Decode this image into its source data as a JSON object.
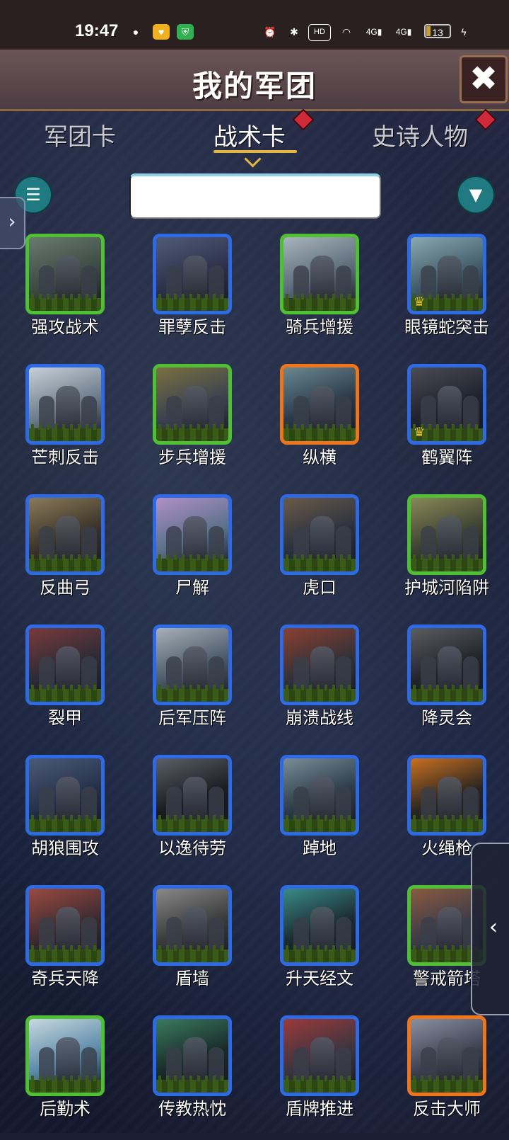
{
  "status_bar": {
    "time": "19:47",
    "battery": "13",
    "icons": [
      "wechat-icon",
      "app-icon",
      "shield-app-icon",
      "alarm-icon",
      "bluetooth-icon",
      "hd-icon",
      "wifi-icon",
      "signal-4g-icon",
      "signal-4g-icon",
      "battery-icon",
      "charging-icon"
    ]
  },
  "header": {
    "title": "我的军团",
    "close_label": "✖"
  },
  "tabs": [
    {
      "label": "军团卡",
      "active": false,
      "badge": false
    },
    {
      "label": "战术卡",
      "active": true,
      "badge": true
    },
    {
      "label": "史诗人物",
      "active": false,
      "badge": true
    }
  ],
  "search": {
    "value": "",
    "placeholder": ""
  },
  "cards": [
    {
      "name": "强攻战术",
      "rarity": "green",
      "palette": [
        "#3b4a40",
        "#6a7a70"
      ],
      "crown": false
    },
    {
      "name": "罪孽反击",
      "rarity": "blue",
      "palette": [
        "#2c3148",
        "#505a78"
      ],
      "crown": false
    },
    {
      "name": "骑兵增援",
      "rarity": "green",
      "palette": [
        "#5a6a78",
        "#a8b4bc"
      ],
      "crown": false
    },
    {
      "name": "眼镜蛇突击",
      "rarity": "blue",
      "palette": [
        "#3e5a68",
        "#8aa8b0"
      ],
      "crown": true
    },
    {
      "name": "芒刺反击",
      "rarity": "blue",
      "palette": [
        "#6a7a88",
        "#c8d0d8"
      ],
      "crown": false
    },
    {
      "name": "步兵增援",
      "rarity": "green",
      "palette": [
        "#3a4250",
        "#7a7040"
      ],
      "crown": false
    },
    {
      "name": "纵横",
      "rarity": "orange",
      "palette": [
        "#2a3848",
        "#6a8890"
      ],
      "crown": false
    },
    {
      "name": "鹤翼阵",
      "rarity": "blue",
      "palette": [
        "#1e222c",
        "#4a4c54"
      ],
      "crown": true
    },
    {
      "name": "反曲弓",
      "rarity": "blue",
      "palette": [
        "#3a3228",
        "#8a7a5a"
      ],
      "crown": false
    },
    {
      "name": "尸解",
      "rarity": "blue",
      "palette": [
        "#5a7088",
        "#b090c8"
      ],
      "crown": false
    },
    {
      "name": "虎口",
      "rarity": "blue",
      "palette": [
        "#2a3040",
        "#6a5a48"
      ],
      "crown": false
    },
    {
      "name": "护城河陷阱",
      "rarity": "green",
      "palette": [
        "#3a4030",
        "#8a8858"
      ],
      "crown": false
    },
    {
      "name": "裂甲",
      "rarity": "blue",
      "palette": [
        "#2a2a38",
        "#7a3a3a"
      ],
      "crown": false
    },
    {
      "name": "后军压阵",
      "rarity": "blue",
      "palette": [
        "#4a5868",
        "#a8b0b8"
      ],
      "crown": false
    },
    {
      "name": "崩溃战线",
      "rarity": "blue",
      "palette": [
        "#303038",
        "#8a4030"
      ],
      "crown": false
    },
    {
      "name": "降灵会",
      "rarity": "blue",
      "palette": [
        "#202428",
        "#5a5c60"
      ],
      "crown": false
    },
    {
      "name": "胡狼围攻",
      "rarity": "blue",
      "palette": [
        "#243048",
        "#4a5a78"
      ],
      "crown": false
    },
    {
      "name": "以逸待劳",
      "rarity": "blue",
      "palette": [
        "#1a1c20",
        "#5a6068"
      ],
      "crown": false
    },
    {
      "name": "踔地",
      "rarity": "blue",
      "palette": [
        "#2a3a48",
        "#7a8c98"
      ],
      "crown": false
    },
    {
      "name": "火绳枪",
      "rarity": "blue",
      "palette": [
        "#2a2420",
        "#c87020"
      ],
      "crown": false
    },
    {
      "name": "奇兵天降",
      "rarity": "blue",
      "palette": [
        "#3a2a30",
        "#9a4a40"
      ],
      "crown": false
    },
    {
      "name": "盾墙",
      "rarity": "blue",
      "palette": [
        "#3a3a3a",
        "#8a8888"
      ],
      "crown": false
    },
    {
      "name": "升天经文",
      "rarity": "blue",
      "palette": [
        "#1a2a30",
        "#3a8a88"
      ],
      "crown": false
    },
    {
      "name": "警戒箭塔",
      "rarity": "green",
      "palette": [
        "#3a3a48",
        "#8a5a40"
      ],
      "crown": false
    },
    {
      "name": "后勤术",
      "rarity": "green",
      "palette": [
        "#5a8aa8",
        "#c8d8e0"
      ],
      "crown": false
    },
    {
      "name": "传教热忱",
      "rarity": "blue",
      "palette": [
        "#1a2a28",
        "#3a7a60"
      ],
      "crown": false
    },
    {
      "name": "盾牌推进",
      "rarity": "blue",
      "palette": [
        "#3a3440",
        "#9a3a3a"
      ],
      "crown": false
    },
    {
      "name": "反击大师",
      "rarity": "orange",
      "palette": [
        "#3a4050",
        "#8a90a0"
      ],
      "crown": false
    }
  ],
  "colors": {
    "accent_gold": "#e3b640",
    "rarity_blue": "#2e6ae6",
    "rarity_green": "#4fbf33",
    "rarity_orange": "#f0741a",
    "badge_red": "#d02a3a",
    "button_teal": "#1f7a82"
  }
}
